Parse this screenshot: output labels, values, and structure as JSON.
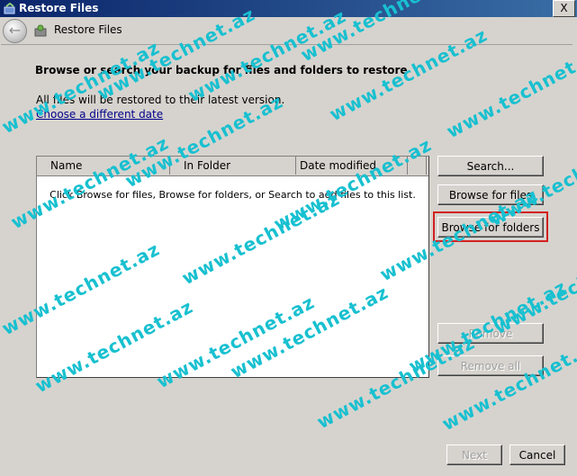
{
  "window": {
    "title": "Restore Files",
    "close_label": "X"
  },
  "header": {
    "title": "Restore Files"
  },
  "main": {
    "heading": "Browse or search your backup for files and folders to restore",
    "info": "All files will be restored to their latest version.",
    "choose_date_link": "Choose a different date"
  },
  "list": {
    "columns": [
      "Name",
      "In Folder",
      "Date modified"
    ],
    "empty_message": "Click Browse for files, Browse for folders, or Search to add files to this list."
  },
  "buttons": {
    "search": "Search...",
    "browse_files": "Browse for files",
    "browse_folders": "Browse for folders",
    "remove": "Remove",
    "remove_all": "Remove all"
  },
  "footer": {
    "next": "Next",
    "cancel": "Cancel"
  },
  "watermark": "www.technet.az",
  "colors": {
    "title_bar": "#0a246a",
    "highlight": "#d32020",
    "watermark": "#18c0d0"
  }
}
